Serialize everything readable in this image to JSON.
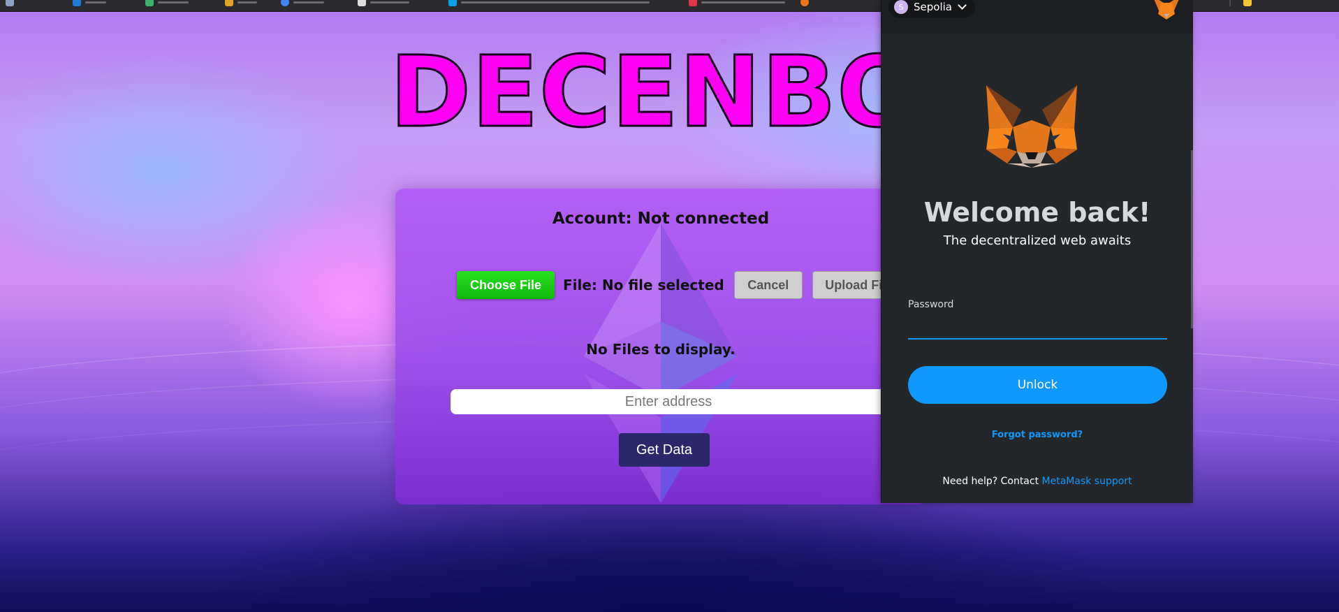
{
  "page": {
    "title": "DECENBOX",
    "account_text": "Account: Not connected",
    "choose_file_label": "Choose File",
    "file_label": "File: No file selected",
    "cancel_label": "Cancel",
    "upload_label": "Upload File",
    "no_files_text": "No Files to display.",
    "address_placeholder": "Enter address",
    "get_data_label": "Get Data"
  },
  "metamask": {
    "network_initial": "S",
    "network_name": "Sepolia",
    "welcome_title": "Welcome back!",
    "welcome_subtitle": "The decentralized web awaits",
    "password_label": "Password",
    "unlock_label": "Unlock",
    "forgot_password": "Forgot password?",
    "help_text": "Need help? Contact ",
    "help_link": "MetaMask support"
  },
  "icons": {
    "network": "network-badge-icon",
    "dropdown": "chevron-down-icon",
    "fox": "metamask-fox-icon",
    "ethereum": "ethereum-logo-icon"
  },
  "colors": {
    "title": "#ff00f5",
    "choose_button": "#1fd016",
    "get_data_button": "#2b2869",
    "metamask_bg": "#24272a",
    "metamask_accent": "#1098fc"
  }
}
